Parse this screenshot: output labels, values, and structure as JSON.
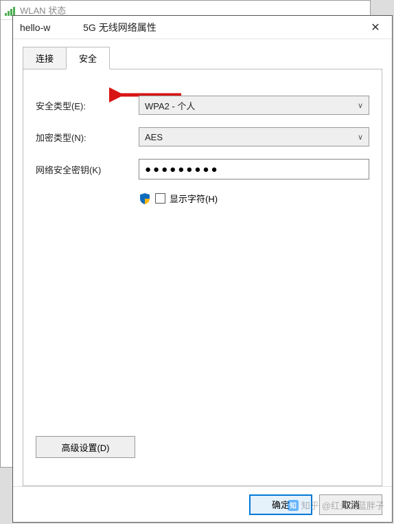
{
  "parent_window": {
    "title": "WLAN 状态"
  },
  "dialog": {
    "title_prefix": "hello-w",
    "title_suffix": "5G 无线网络属性",
    "tabs": {
      "connect": "连接",
      "security": "安全"
    },
    "labels": {
      "security_type": "安全类型(E):",
      "encryption_type": "加密类型(N):",
      "network_key": "网络安全密钥(K)"
    },
    "values": {
      "security_type": "WPA2 - 个人",
      "encryption_type": "AES",
      "password_mask": "●●●●●●●●●"
    },
    "checkbox": {
      "show_chars": "显示字符(H)"
    },
    "buttons": {
      "advanced": "高级设置(D)",
      "ok": "确定",
      "cancel": "取消"
    }
  },
  "watermark": {
    "brand": "知乎",
    "handle": "@红头发蓝胖子"
  }
}
